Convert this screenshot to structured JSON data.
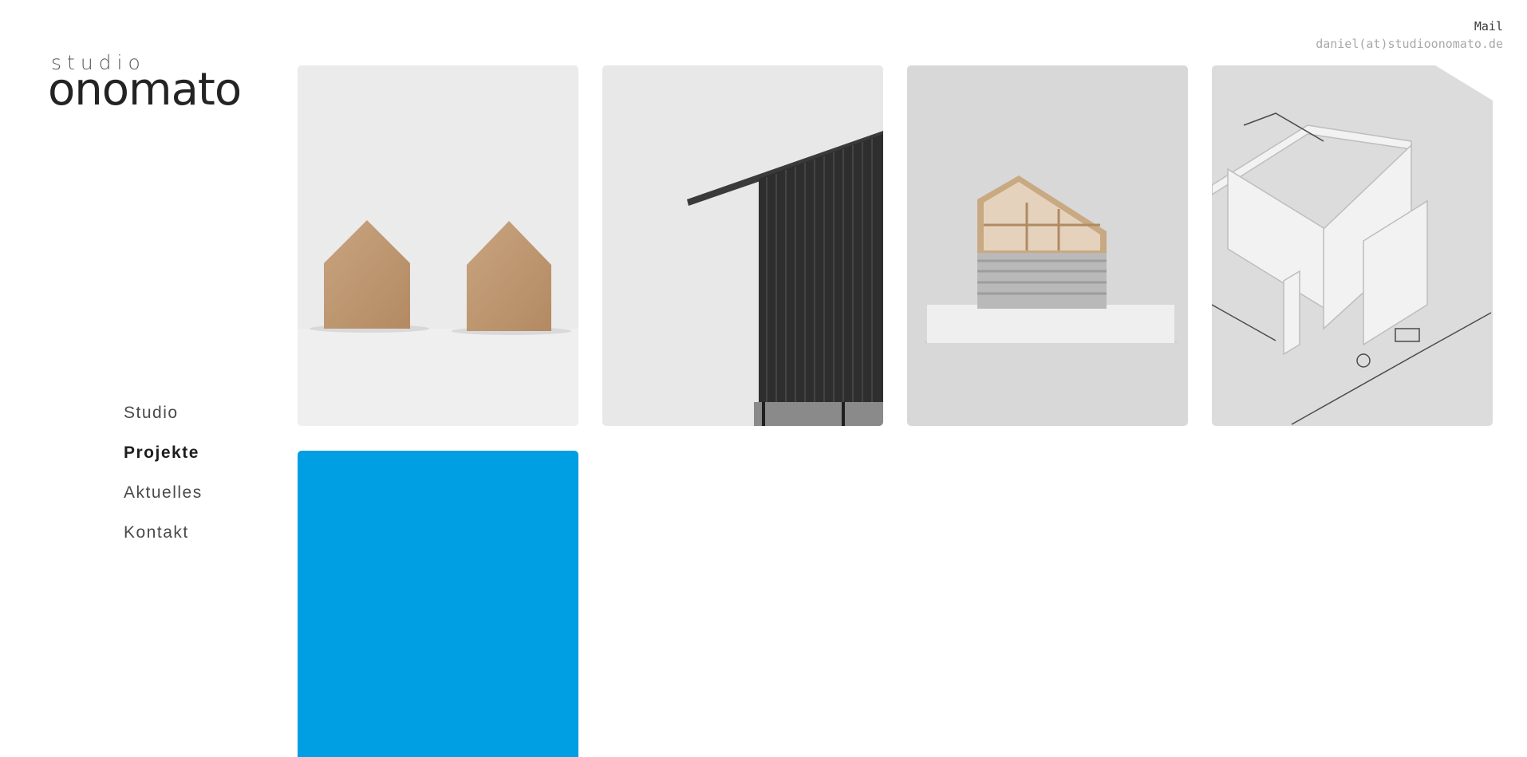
{
  "brand": {
    "top": "studio",
    "main": "onomato"
  },
  "contact": {
    "label": "Mail",
    "email": "daniel(at)studioonomato.de"
  },
  "nav": {
    "items": [
      {
        "label": "Studio",
        "active": false
      },
      {
        "label": "Projekte",
        "active": true
      },
      {
        "label": "Aktuelles",
        "active": false
      },
      {
        "label": "Kontakt",
        "active": false
      }
    ]
  },
  "projects": [
    {
      "image": "wooden-house-shapes-icon",
      "background": "#ebebeb"
    },
    {
      "image": "dark-timber-facade-icon",
      "background": "#e8e8e8"
    },
    {
      "image": "house-section-model-icon",
      "background": "#d8d8d8"
    },
    {
      "image": "white-floor-plan-model-icon",
      "background": "#dcdcdc"
    },
    {
      "image": "blue-color-field",
      "background": "#009ee2"
    }
  ],
  "colors": {
    "accent_blue": "#009ee2",
    "text": "#2a2a2a",
    "muted": "#a8a8a8"
  }
}
